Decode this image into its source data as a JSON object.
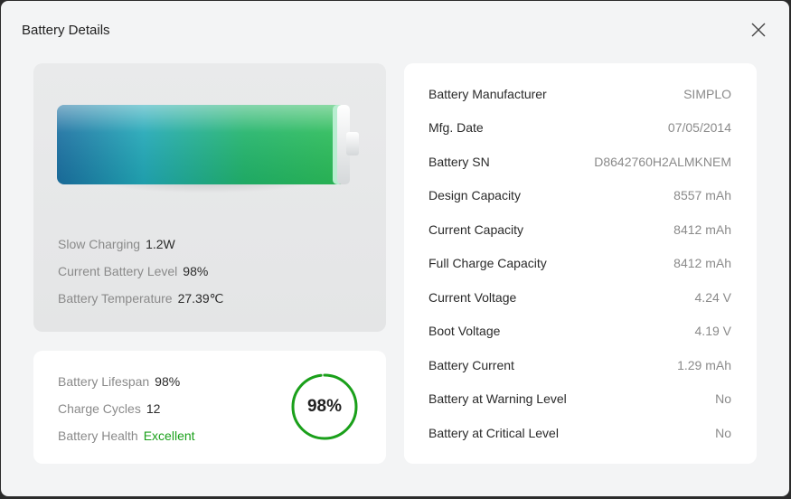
{
  "window": {
    "title": "Battery Details"
  },
  "status": {
    "charging_label": "Slow Charging",
    "charging_value": "1.2W",
    "level_label": "Current Battery Level",
    "level_value": "98%",
    "temp_label": "Battery Temperature",
    "temp_value": "27.39℃"
  },
  "health": {
    "lifespan_label": "Battery Lifespan",
    "lifespan_value": "98%",
    "cycles_label": "Charge Cycles",
    "cycles_value": "12",
    "health_label": "Battery Health",
    "health_value": "Excellent",
    "ring_percent": "98%",
    "ring_fraction": 0.98
  },
  "details": [
    {
      "label": "Battery Manufacturer",
      "value": "SIMPLO"
    },
    {
      "label": "Mfg. Date",
      "value": "07/05/2014"
    },
    {
      "label": "Battery SN",
      "value": "D8642760H2ALMKNEM"
    },
    {
      "label": "Design Capacity",
      "value": "8557 mAh"
    },
    {
      "label": "Current Capacity",
      "value": "8412 mAh"
    },
    {
      "label": "Full Charge Capacity",
      "value": "8412 mAh"
    },
    {
      "label": "Current Voltage",
      "value": "4.24 V"
    },
    {
      "label": "Boot Voltage",
      "value": "4.19 V"
    },
    {
      "label": "Battery Current",
      "value": "1.29 mAh"
    },
    {
      "label": "Battery at Warning Level",
      "value": "No"
    },
    {
      "label": "Battery at Critical Level",
      "value": "No"
    }
  ],
  "colors": {
    "accent": "#1aa01a",
    "ring_track": "#e6e6e6"
  },
  "icons": {
    "close": "close-icon",
    "battery": "battery-icon"
  }
}
